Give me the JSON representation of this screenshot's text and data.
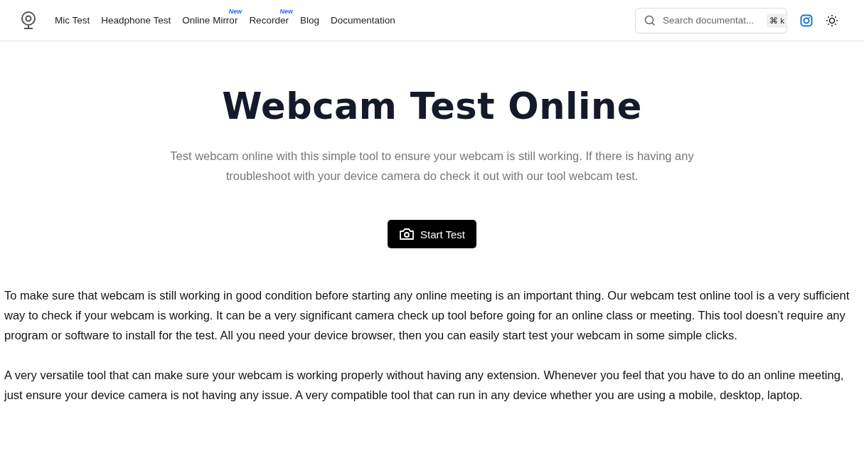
{
  "nav": {
    "items": [
      {
        "label": "Mic Test"
      },
      {
        "label": "Headphone Test"
      },
      {
        "label": "Online Mirror",
        "badge": "New"
      },
      {
        "label": "Recorder",
        "badge": "New"
      },
      {
        "label": "Blog"
      },
      {
        "label": "Documentation"
      }
    ],
    "search": {
      "placeholder": "Search documentat...",
      "shortcut": "⌘ k"
    }
  },
  "hero": {
    "title": "Webcam Test Online",
    "subtitle": "Test webcam online with this simple tool to ensure your webcam is still working. If there is having any troubleshoot with your device camera do check it out with our tool webcam test.",
    "button": "Start Test"
  },
  "paragraphs": [
    "To make sure that webcam is still working in good condition before starting any online meeting is an important thing. Our webcam test online tool is a very sufficient way to check if your webcam is working. It can be a very significant camera check up tool before going for an online class or meeting. This tool doesn’t require any program or software to install for the test. All you need your device browser, then you can easily start test your webcam in some simple clicks.",
    "A very versatile tool that can make sure your webcam is working properly without having any extension. Whenever you feel that you have to do an online meeting, just ensure your device camera is not having any issue. A very compatible tool that can run in any device whether you are using a mobile, desktop, laptop."
  ]
}
